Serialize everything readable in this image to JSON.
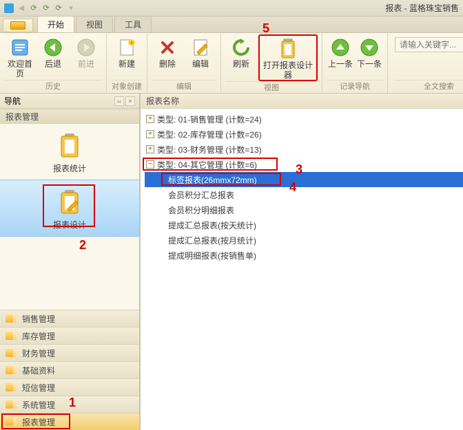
{
  "window": {
    "title": "报表 - 蓝格珠宝销售"
  },
  "tabs": {
    "start": "开始",
    "view": "视图",
    "tools": "工具"
  },
  "ribbon": {
    "history": {
      "home": "欢迎首页",
      "back": "后退",
      "forward": "前进",
      "groupname": "历史"
    },
    "create": {
      "new": "新建",
      "groupname": "对象创建"
    },
    "edit": {
      "delete": "删除",
      "edit": "编辑",
      "groupname": "编辑"
    },
    "viewg": {
      "refresh": "刷新",
      "designer": "打开报表设计器",
      "groupname": "视图"
    },
    "nav": {
      "prev": "上一条",
      "next": "下一条",
      "groupname": "记录导航"
    },
    "search": {
      "placeholder": "请输入关键字...",
      "groupname": "全文搜索"
    }
  },
  "nav": {
    "title": "导航",
    "section": "报表管理",
    "blocks": {
      "stats": "报表统计",
      "design": "报表设计"
    },
    "accordions": [
      "销售管理",
      "库存管理",
      "财务管理",
      "基础资料",
      "短信管理",
      "系统管理",
      "报表管理"
    ]
  },
  "content": {
    "column": "报表名称",
    "groups": [
      {
        "label": "类型: 01-销售管理 (计数=24)",
        "expanded": false
      },
      {
        "label": "类型: 02-库存管理 (计数=26)",
        "expanded": false
      },
      {
        "label": "类型: 03-财务管理 (计数=13)",
        "expanded": false
      },
      {
        "label": "类型: 04-其它管理 (计数=6)",
        "expanded": true,
        "children": [
          "标签报表(26mmx72mm)",
          "会员积分汇总报表",
          "会员积分明细报表",
          "提成汇总报表(按天统计)",
          "提成汇总报表(按月统计)",
          "提成明细报表(按销售单)"
        ]
      }
    ]
  },
  "annotations": {
    "a1": "1",
    "a2": "2",
    "a3": "3",
    "a4": "4",
    "a5": "5"
  }
}
